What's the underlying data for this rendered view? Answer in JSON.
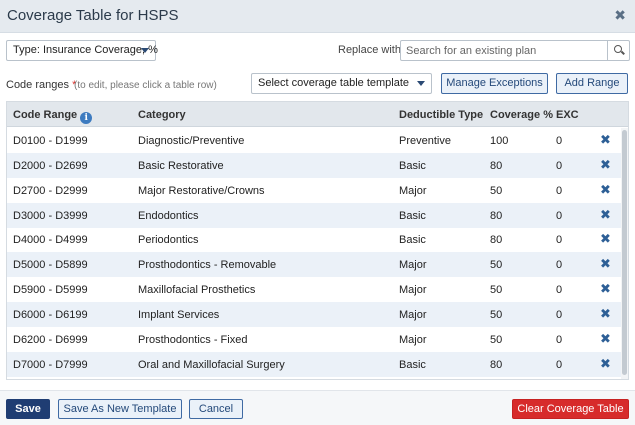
{
  "window": {
    "title": "Coverage Table for HSPS",
    "close_glyph": "✖"
  },
  "filters": {
    "type_select": "Type: Insurance Coverage, %",
    "replace_label": "Replace with",
    "search_placeholder": "Search for an existing plan"
  },
  "code_ranges": {
    "label": "Code ranges",
    "required_mark": "*",
    "hint": "(to edit, please click a table row)",
    "template_select": "Select coverage table template",
    "manage_exceptions": "Manage Exceptions",
    "add_range": "Add Range"
  },
  "table": {
    "headers": {
      "code_range": "Code Range",
      "info_glyph": "i",
      "category": "Category",
      "deductible_type": "Deductible Type",
      "coverage": "Coverage %",
      "exc": "EXC"
    },
    "delete_glyph": "✖",
    "rows": [
      {
        "code_range": "D0100 - D1999",
        "category": "Diagnostic/Preventive",
        "deductible_type": "Preventive",
        "coverage": "100",
        "exc": "0"
      },
      {
        "code_range": "D2000 - D2699",
        "category": "Basic Restorative",
        "deductible_type": "Basic",
        "coverage": "80",
        "exc": "0"
      },
      {
        "code_range": "D2700 - D2999",
        "category": "Major Restorative/Crowns",
        "deductible_type": "Major",
        "coverage": "50",
        "exc": "0"
      },
      {
        "code_range": "D3000 - D3999",
        "category": "Endodontics",
        "deductible_type": "Basic",
        "coverage": "80",
        "exc": "0"
      },
      {
        "code_range": "D4000 - D4999",
        "category": "Periodontics",
        "deductible_type": "Basic",
        "coverage": "80",
        "exc": "0"
      },
      {
        "code_range": "D5000 - D5899",
        "category": "Prosthodontics - Removable",
        "deductible_type": "Major",
        "coverage": "50",
        "exc": "0"
      },
      {
        "code_range": "D5900 - D5999",
        "category": "Maxillofacial Prosthetics",
        "deductible_type": "Major",
        "coverage": "50",
        "exc": "0"
      },
      {
        "code_range": "D6000 - D6199",
        "category": "Implant Services",
        "deductible_type": "Major",
        "coverage": "50",
        "exc": "0"
      },
      {
        "code_range": "D6200 - D6999",
        "category": "Prosthodontics - Fixed",
        "deductible_type": "Major",
        "coverage": "50",
        "exc": "0"
      },
      {
        "code_range": "D7000 - D7999",
        "category": "Oral and Maxillofacial Surgery",
        "deductible_type": "Basic",
        "coverage": "80",
        "exc": "0"
      }
    ]
  },
  "footer": {
    "save": "Save",
    "save_as_template": "Save As New Template",
    "cancel": "Cancel",
    "clear": "Clear Coverage Table"
  },
  "colors": {
    "primary": "#1f3d73",
    "danger": "#d72b2b",
    "row_alt": "#ebf1f8",
    "header_bg": "#e2e7ec"
  }
}
